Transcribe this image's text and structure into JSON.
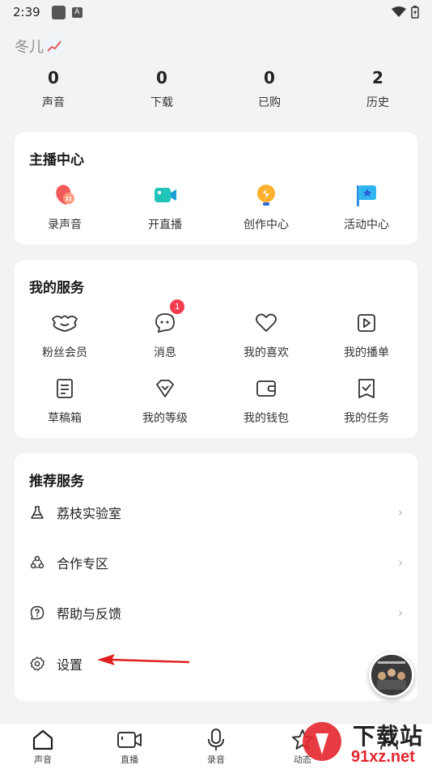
{
  "status_bar": {
    "time": "2:39",
    "notif_a": "A"
  },
  "profile": {
    "username": "冬儿",
    "stats": [
      {
        "value": "0",
        "label": "声音"
      },
      {
        "value": "0",
        "label": "下载"
      },
      {
        "value": "0",
        "label": "已购"
      },
      {
        "value": "2",
        "label": "历史"
      }
    ]
  },
  "anchor_center": {
    "title": "主播中心",
    "items": [
      {
        "label": "录声音",
        "icon": "record-voice-icon"
      },
      {
        "label": "开直播",
        "icon": "live-camera-icon"
      },
      {
        "label": "创作中心",
        "icon": "creation-bulb-icon"
      },
      {
        "label": "活动中心",
        "icon": "activity-flag-icon"
      }
    ]
  },
  "my_services": {
    "title": "我的服务",
    "items": [
      {
        "label": "粉丝会员",
        "icon": "fan-member-icon"
      },
      {
        "label": "消息",
        "icon": "message-icon",
        "badge": "1"
      },
      {
        "label": "我的喜欢",
        "icon": "heart-icon"
      },
      {
        "label": "我的播单",
        "icon": "playlist-icon"
      },
      {
        "label": "草稿箱",
        "icon": "draft-icon"
      },
      {
        "label": "我的等级",
        "icon": "level-diamond-icon"
      },
      {
        "label": "我的钱包",
        "icon": "wallet-icon"
      },
      {
        "label": "我的任务",
        "icon": "task-icon"
      }
    ]
  },
  "recommended": {
    "title": "推荐服务",
    "items": [
      {
        "label": "荔枝实验室",
        "icon": "flask-icon",
        "chevron": "›"
      },
      {
        "label": "合作专区",
        "icon": "cooperation-icon",
        "chevron": "›"
      },
      {
        "label": "帮助与反馈",
        "icon": "help-icon",
        "chevron": "›"
      },
      {
        "label": "设置",
        "icon": "settings-gear-icon",
        "chevron": ""
      }
    ]
  },
  "bottom_nav": [
    {
      "label": "声音",
      "icon": "home-icon"
    },
    {
      "label": "直播",
      "icon": "live-icon"
    },
    {
      "label": "录音",
      "icon": "mic-icon"
    },
    {
      "label": "动态",
      "icon": "star-icon"
    },
    {
      "label": "",
      "icon": "profile-icon"
    }
  ],
  "watermark": {
    "text_cn": "下载站",
    "text_url": "91xz.net"
  },
  "colors": {
    "badge": "#f23b4d",
    "arrow": "#e02020",
    "background": "#f2f3f5"
  }
}
